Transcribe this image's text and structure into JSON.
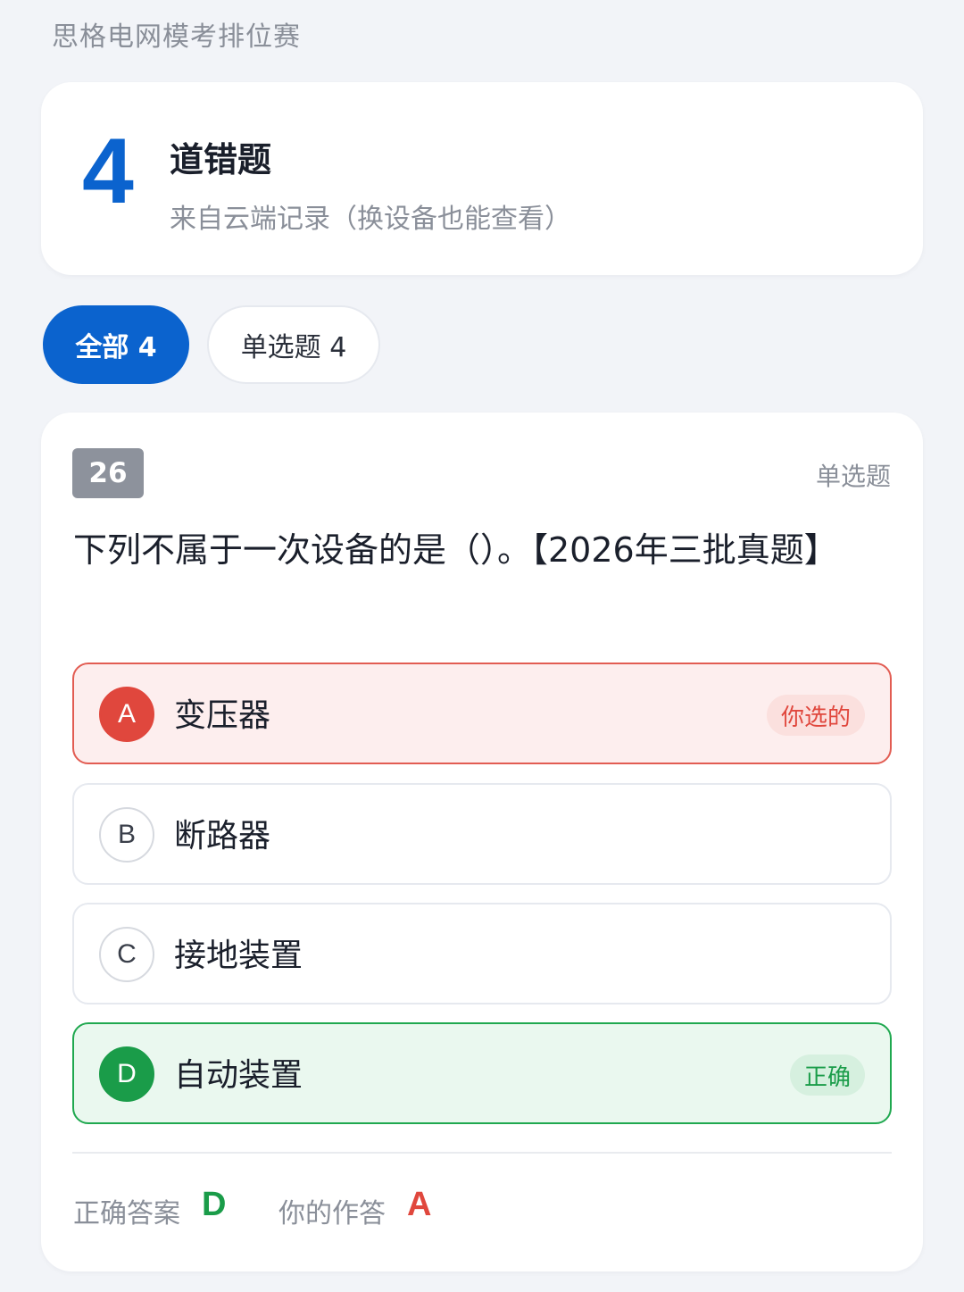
{
  "app_title": "思格电网模考排位赛",
  "summary": {
    "count": "4",
    "title": "道错题",
    "subtitle": "来自云端记录（换设备也能查看）"
  },
  "filters": {
    "all_label": "全部 4",
    "single_label": "单选题 4"
  },
  "question": {
    "number": "26",
    "type": "单选题",
    "text": "下列不属于一次设备的是（）。【2026年三批真题】",
    "options": [
      {
        "letter": "A",
        "text": "变压器",
        "badge": "你选的",
        "state": "wrong"
      },
      {
        "letter": "B",
        "text": "断路器",
        "badge": "",
        "state": "normal"
      },
      {
        "letter": "C",
        "text": "接地装置",
        "badge": "",
        "state": "normal"
      },
      {
        "letter": "D",
        "text": "自动装置",
        "badge": "正确",
        "state": "right"
      }
    ],
    "correct_label": "正确答案",
    "correct_value": "D",
    "your_label": "你的作答",
    "your_value": "A"
  },
  "colors": {
    "accent": "#0b63ce",
    "wrong": "#e0473d",
    "right": "#1a9c49"
  }
}
